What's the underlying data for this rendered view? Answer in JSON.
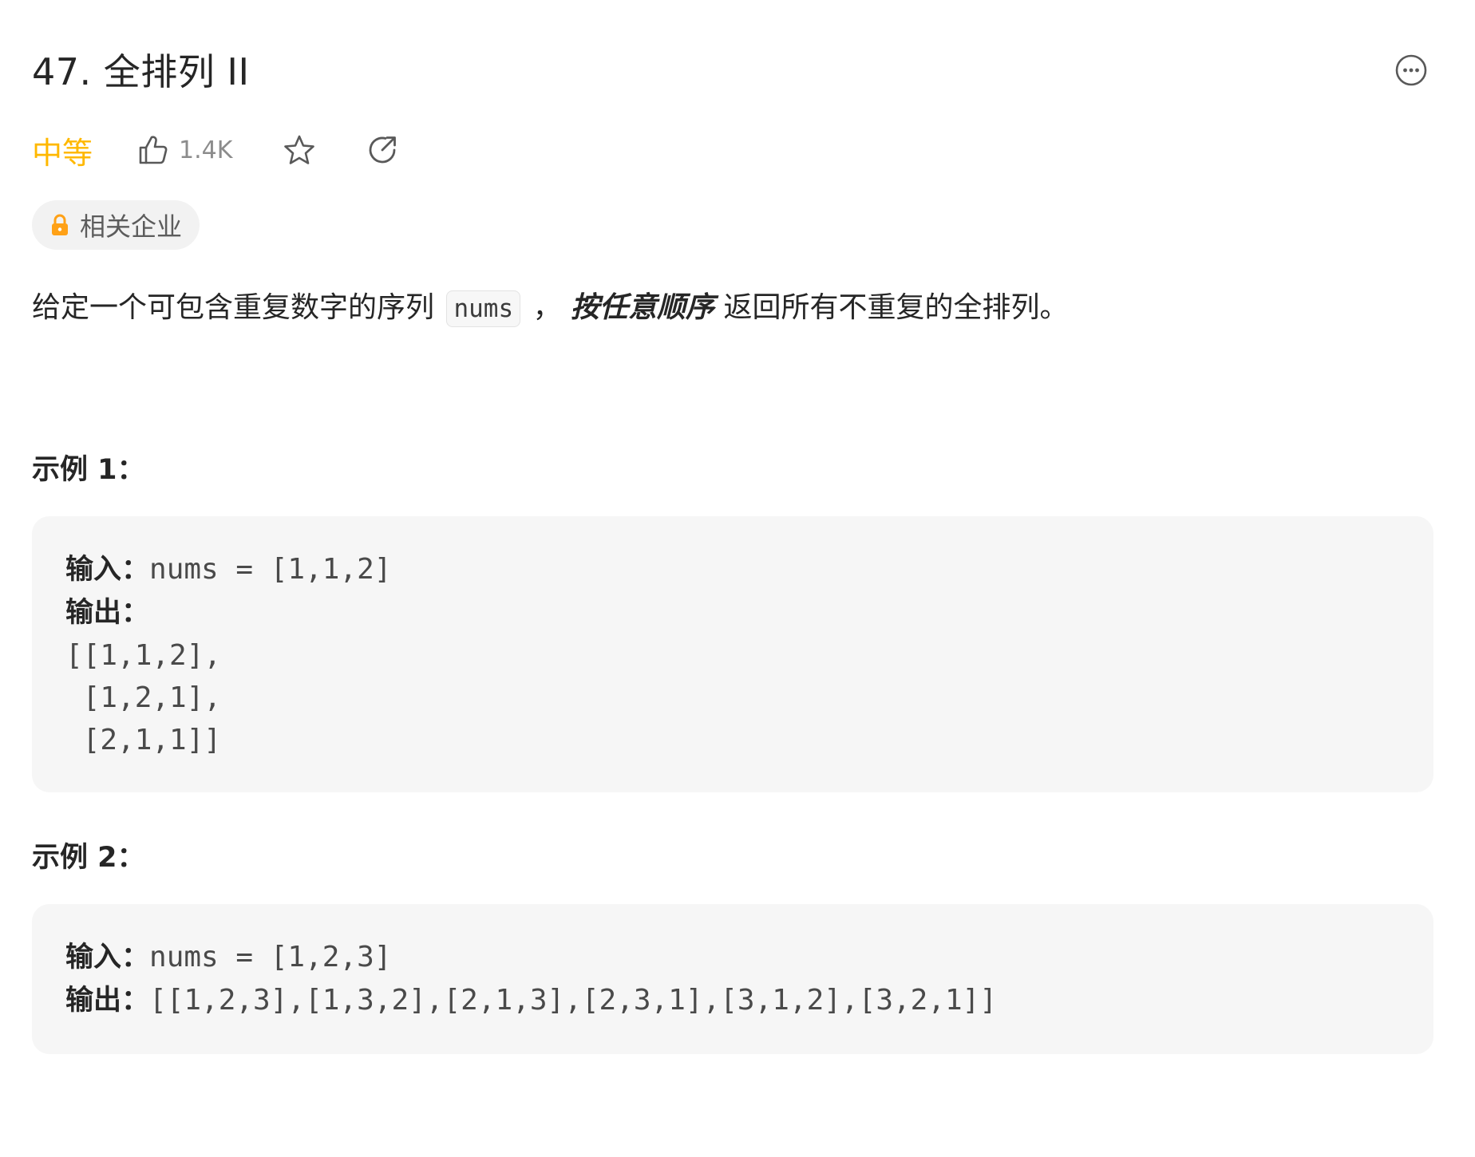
{
  "problem": {
    "title": "47. 全排列 II",
    "difficulty": "中等",
    "likes": "1.4K",
    "company_tag": "相关企业"
  },
  "description": {
    "prefix": "给定一个可包含重复数字的序列",
    "code": "nums",
    "comma": "，",
    "emphasis": "按任意顺序",
    "suffix": "返回所有不重复的全排列。"
  },
  "examples": [
    {
      "heading": "示例 1：",
      "input_label": "输入：",
      "input_value": "nums = [1,1,2]",
      "output_label": "输出：",
      "output_lines": [
        "[[1,1,2],",
        " [1,2,1],",
        " [2,1,1]]"
      ]
    },
    {
      "heading": "示例 2：",
      "input_label": "输入：",
      "input_value": "nums = [1,2,3]",
      "output_label": "输出：",
      "output_value": "[[1,2,3],[1,3,2],[2,1,3],[2,3,1],[3,1,2],[3,2,1]]"
    }
  ],
  "colors": {
    "difficulty_medium": "#ffb800",
    "lock_icon": "#ffa116",
    "text_primary": "#262626",
    "code_bg": "#f6f6f6"
  },
  "icons": [
    "more-icon",
    "thumbs-up-icon",
    "star-icon",
    "share-icon",
    "lock-icon"
  ]
}
